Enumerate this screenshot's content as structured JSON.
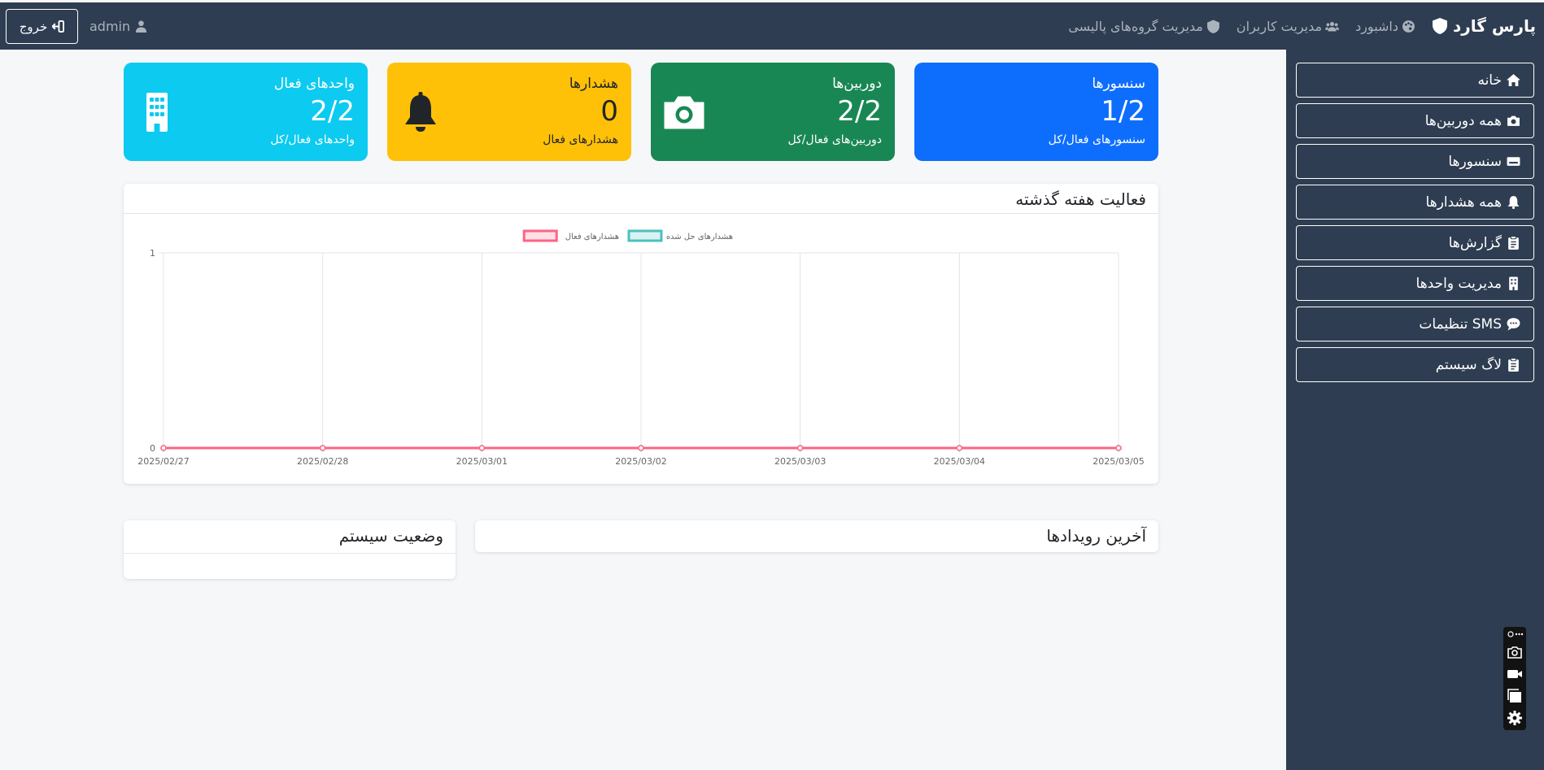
{
  "navbar": {
    "brand": "پارس گارد",
    "links": [
      {
        "label": "داشبورد",
        "icon": "palette-icon"
      },
      {
        "label": "مدیریت کاربران",
        "icon": "users-icon"
      },
      {
        "label": "مدیریت گروه‌های پالیسی",
        "icon": "shield-icon"
      }
    ],
    "user": "admin",
    "logout_label": "خروج"
  },
  "sidebar": {
    "items": [
      {
        "label": "خانه",
        "icon": "home-icon"
      },
      {
        "label": "همه دوربین‌ها",
        "icon": "camera-icon"
      },
      {
        "label": "سنسورها",
        "icon": "sensor-icon"
      },
      {
        "label": "همه هشدارها",
        "icon": "bell-icon"
      },
      {
        "label": "گزارش‌ها",
        "icon": "clipboard-icon"
      },
      {
        "label": "مدیریت واحدها",
        "icon": "building-icon"
      },
      {
        "label": "تنظیمات SMS",
        "icon": "comment-icon"
      },
      {
        "label": "لاگ سیستم",
        "icon": "clipboard-icon"
      }
    ]
  },
  "cards": {
    "sensors": {
      "title": "سنسورها",
      "value": "1/2",
      "sub": "سنسورهای فعال/کل",
      "color": "#0d6efd"
    },
    "cameras": {
      "title": "دوربین‌ها",
      "value": "2/2",
      "sub": "دوربین‌های فعال/کل",
      "color": "#198754",
      "icon": "camera-icon"
    },
    "alerts": {
      "title": "هشدارها",
      "value": "0",
      "sub": "هشدارهای فعال",
      "color": "#ffc107",
      "icon": "bell-icon"
    },
    "units": {
      "title": "واحدهای فعال",
      "value": "2/2",
      "sub": "واحدهای فعال/کل",
      "color": "#0dcaf0",
      "icon": "building-icon"
    }
  },
  "activity": {
    "title": "فعالیت هفته گذشته"
  },
  "events": {
    "title": "آخرین رویدادها"
  },
  "system_status": {
    "title": "وضعیت سیستم"
  },
  "chart_data": {
    "type": "line",
    "x": [
      "2025/02/27",
      "2025/02/28",
      "2025/03/01",
      "2025/03/02",
      "2025/03/03",
      "2025/03/04",
      "2025/03/05"
    ],
    "series": [
      {
        "name": "هشدارهای حل شده",
        "values": [
          0,
          0,
          0,
          0,
          0,
          0,
          0
        ],
        "color": "#4bc0c0"
      },
      {
        "name": "هشدارهای فعال",
        "values": [
          0,
          0,
          0,
          0,
          0,
          0,
          0
        ],
        "color": "#ff6384"
      }
    ],
    "ylim": [
      0,
      1
    ],
    "yticks": [
      "0",
      "1"
    ],
    "grid": true,
    "legend": "top-center"
  }
}
